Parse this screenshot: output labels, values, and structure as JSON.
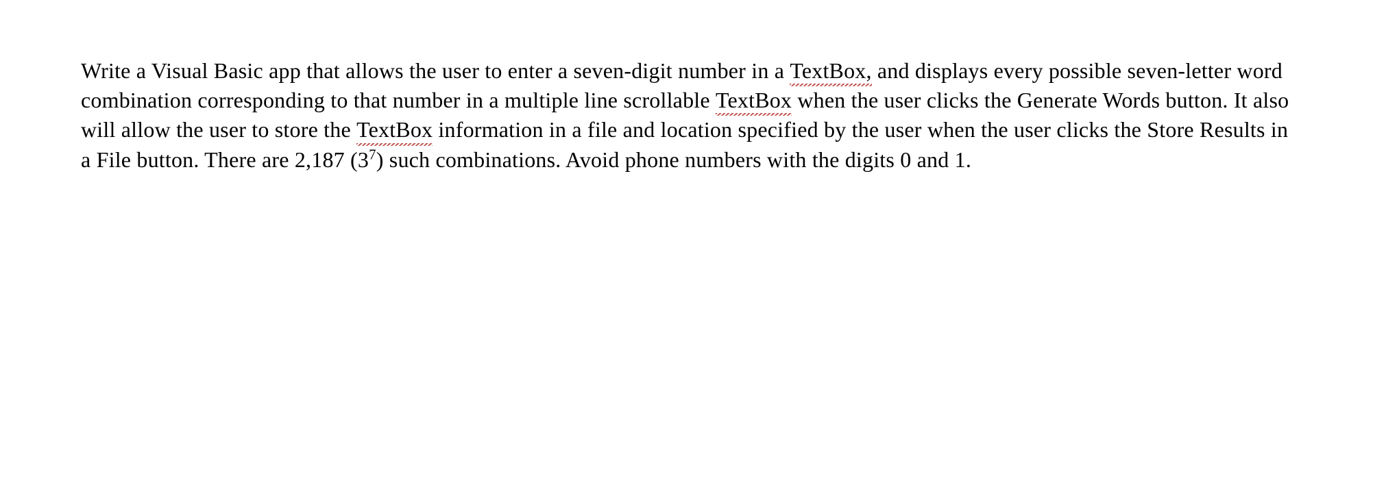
{
  "paragraph": {
    "part1": "Write a Visual Basic app that allows the user to enter a seven-digit number in a ",
    "squiggle1": "TextBox,",
    "part2": " and displays every possible seven-letter word combination corresponding to that number in a multiple line scrollable ",
    "squiggle2": "TextBox",
    "part3": " when the user clicks the Generate Words button. It also will allow the user to store the ",
    "squiggle3": "TextBox",
    "part4": " information in a file and location specified by the user when the user clicks the Store Results in a File button.  There are 2,187 (3",
    "superscript": "7",
    "part5": ") such combinations. Avoid phone numbers with the digits 0 and 1."
  }
}
